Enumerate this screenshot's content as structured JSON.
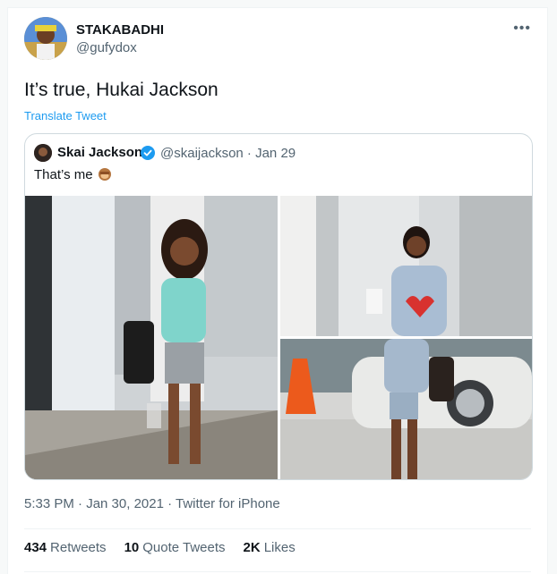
{
  "author": {
    "display_name": "STAKABADHI",
    "handle": "@gufydox",
    "avatar_icon": "profile-avatar"
  },
  "more_label": "•••",
  "tweet": {
    "text": "It’s true, Hukai Jackson",
    "translate_label": "Translate Tweet"
  },
  "quoted": {
    "display_name": "Skai Jackson",
    "verified_icon": "verified-badge-icon",
    "meta": "@skaijackson · Jan 29",
    "text": "That’s me",
    "emoji_icon": "see-no-evil-monkey-icon",
    "photos": [
      "photo-walking-street",
      "photo-holding-cup",
      "photo-by-car"
    ]
  },
  "timestamp": {
    "time": "5:33 PM · Jan 30, 2021 · ",
    "source": "Twitter for iPhone"
  },
  "stats": {
    "retweets_count": "434",
    "retweets_label": "Retweets",
    "quotes_count": "10",
    "quotes_label": "Quote Tweets",
    "likes_count": "2K",
    "likes_label": "Likes"
  },
  "colors": {
    "accent": "#1d9bf0",
    "secondary_text": "#536471",
    "border": "#cfd9de"
  }
}
